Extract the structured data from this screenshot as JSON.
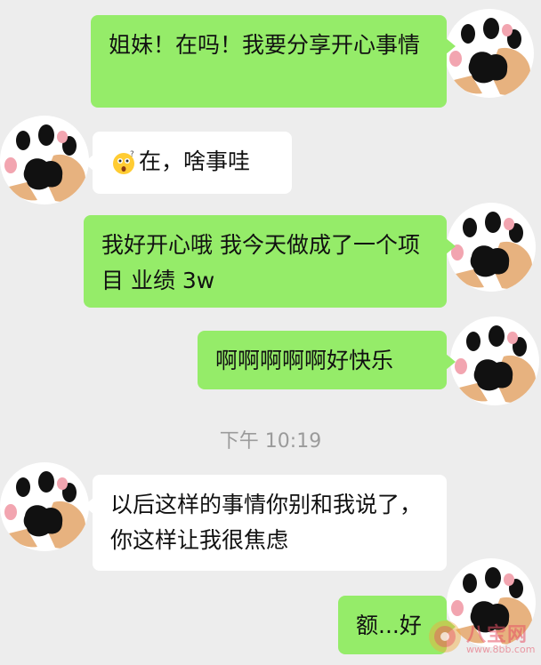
{
  "messages": [
    {
      "side": "me",
      "text": "姐妹！在吗！我要分享开心事情"
    },
    {
      "side": "other",
      "text": "在，啥事哇",
      "emoji": "thinking-face-emoji"
    },
    {
      "side": "me",
      "text": "我好开心哦 我今天做成了一个项目 业绩 3w"
    },
    {
      "side": "me",
      "text": "啊啊啊啊啊好快乐"
    },
    {
      "side": "other",
      "text": "以后这样的事情你别和我说了，你这样让我很焦虑"
    },
    {
      "side": "me",
      "text": "额...好"
    }
  ],
  "timestamp": "下午 10:19",
  "avatar_icon": "cat-paw-icon",
  "watermark": {
    "text": "八宝网",
    "url": "www.8bb.com"
  },
  "colors": {
    "background": "#ededed",
    "my_bubble": "#95ec69",
    "other_bubble": "#ffffff",
    "timestamp": "#9b9b9b"
  }
}
